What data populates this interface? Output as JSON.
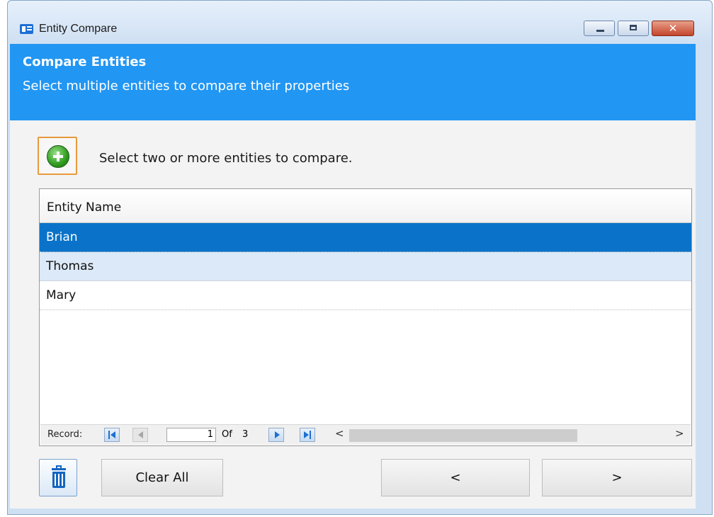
{
  "window": {
    "title": "Entity Compare",
    "controls": {
      "minimize": "minimize",
      "maximize": "maximize",
      "close": "✕"
    }
  },
  "header": {
    "title": "Compare Entities",
    "subtitle": "Select multiple entities to compare their properties",
    "background": "#2196f3"
  },
  "toolbar": {
    "add_icon": "plus-circle-icon",
    "instruction": "Select two or more entities to compare."
  },
  "grid": {
    "column_header": "Entity Name",
    "rows": [
      "Brian",
      "Thomas",
      "Mary"
    ],
    "selected_row": 0
  },
  "navigation": {
    "record_label": "Record:",
    "current": "1",
    "of_label": "Of",
    "total": "3",
    "scroll_left": "<",
    "scroll_right": ">"
  },
  "buttons": {
    "delete_icon": "trash-icon",
    "clear_all": "Clear All",
    "prev": "<",
    "next": ">"
  },
  "colors": {
    "accent": "#2196f3",
    "selected_row": "#0a73c9",
    "alt_row": "#dce9f8"
  }
}
